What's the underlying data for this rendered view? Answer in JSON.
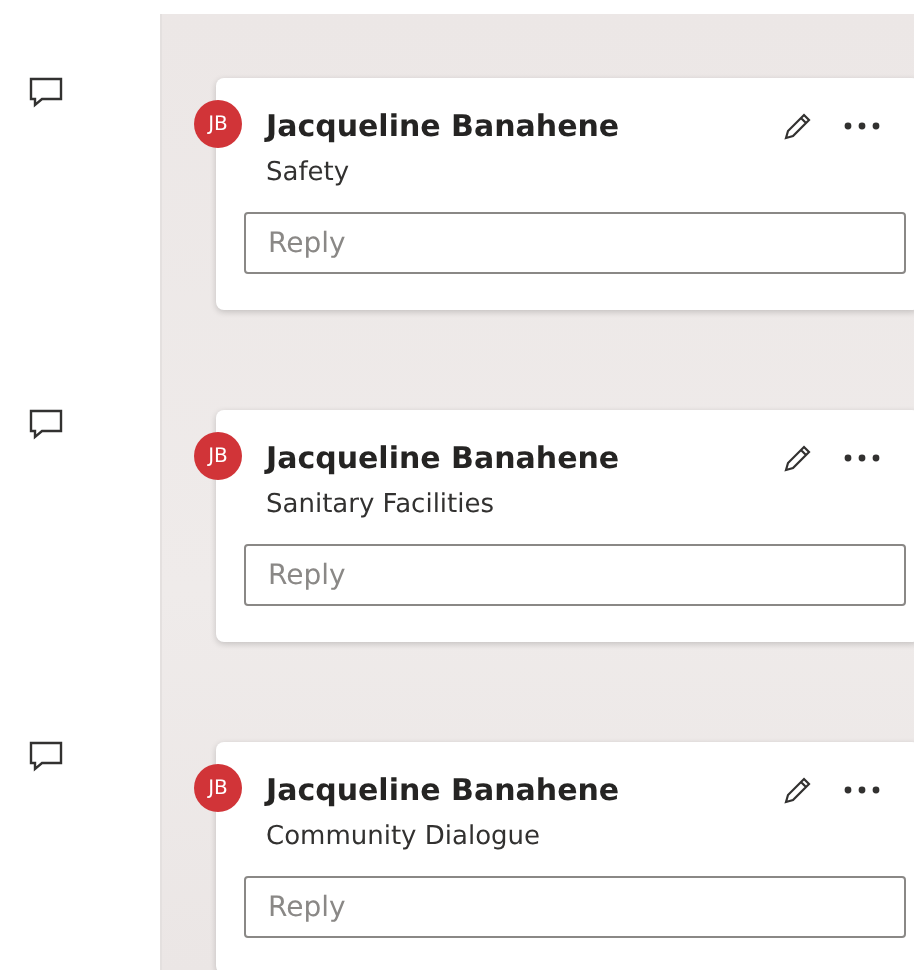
{
  "comments": [
    {
      "initials": "JB",
      "author": "Jacqueline Banahene",
      "text": "Safety",
      "reply": {
        "placeholder": "Reply"
      }
    },
    {
      "initials": "JB",
      "author": "Jacqueline Banahene",
      "text": "Sanitary Facilities",
      "reply": {
        "placeholder": "Reply"
      }
    },
    {
      "initials": "JB",
      "author": "Jacqueline Banahene",
      "text": "Community Dialogue",
      "reply": {
        "placeholder": "Reply"
      }
    }
  ]
}
